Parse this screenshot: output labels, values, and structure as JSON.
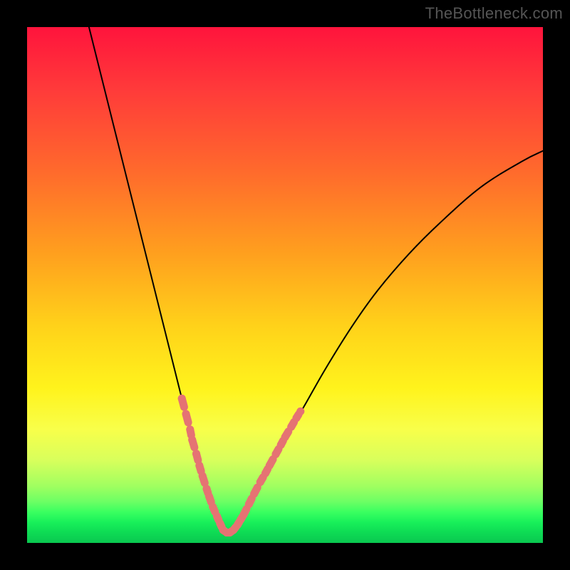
{
  "watermark": "TheBottleneck.com",
  "colors": {
    "frame": "#000000",
    "curve": "#000000",
    "marker_fill": "#e57373",
    "marker_stroke": "#d46a6a"
  },
  "chart_data": {
    "type": "line",
    "title": "",
    "xlabel": "",
    "ylabel": "",
    "xlim": [
      0,
      100
    ],
    "ylim": [
      0,
      100
    ],
    "grid": false,
    "note": "Axis values are in percent of plot area; x left→right, y bottom→top. Curve values estimated from pixel positions.",
    "series": [
      {
        "name": "bottleneck-curve",
        "x": [
          12,
          15,
          18,
          21,
          24,
          27,
          30,
          32,
          34,
          36,
          37,
          38,
          39,
          40,
          42,
          44,
          47,
          50,
          54,
          58,
          63,
          68,
          74,
          80,
          88,
          96,
          100
        ],
        "y": [
          100,
          88,
          76,
          64,
          52,
          40,
          28,
          20,
          13,
          7,
          4,
          2,
          2,
          3,
          5,
          9,
          14,
          20,
          27,
          34,
          42,
          49,
          56,
          62,
          69,
          74,
          76
        ]
      }
    ],
    "markers": {
      "name": "highlight-dots",
      "note": "Pink dot-dash segments drawn on the curve near the valley.",
      "points": [
        {
          "x": 30.0,
          "y": 28.0
        },
        {
          "x": 30.8,
          "y": 25.0
        },
        {
          "x": 31.6,
          "y": 22.0
        },
        {
          "x": 32.0,
          "y": 20.0
        },
        {
          "x": 32.8,
          "y": 17.3
        },
        {
          "x": 33.4,
          "y": 15.0
        },
        {
          "x": 34.0,
          "y": 13.0
        },
        {
          "x": 34.8,
          "y": 10.5
        },
        {
          "x": 35.3,
          "y": 9.0
        },
        {
          "x": 36.0,
          "y": 7.0
        },
        {
          "x": 36.8,
          "y": 5.2
        },
        {
          "x": 37.4,
          "y": 3.8
        },
        {
          "x": 38.0,
          "y": 2.5
        },
        {
          "x": 38.7,
          "y": 2.0
        },
        {
          "x": 39.3,
          "y": 2.0
        },
        {
          "x": 40.0,
          "y": 2.5
        },
        {
          "x": 40.8,
          "y": 3.5
        },
        {
          "x": 41.4,
          "y": 4.5
        },
        {
          "x": 42.0,
          "y": 5.5
        },
        {
          "x": 43.0,
          "y": 7.5
        },
        {
          "x": 44.0,
          "y": 9.5
        },
        {
          "x": 45.2,
          "y": 11.8
        },
        {
          "x": 46.2,
          "y": 13.5
        },
        {
          "x": 47.0,
          "y": 15.0
        },
        {
          "x": 48.2,
          "y": 17.2
        },
        {
          "x": 49.2,
          "y": 19.0
        },
        {
          "x": 50.0,
          "y": 20.5
        },
        {
          "x": 51.2,
          "y": 22.5
        },
        {
          "x": 52.2,
          "y": 24.2
        },
        {
          "x": 53.0,
          "y": 25.5
        }
      ]
    }
  }
}
